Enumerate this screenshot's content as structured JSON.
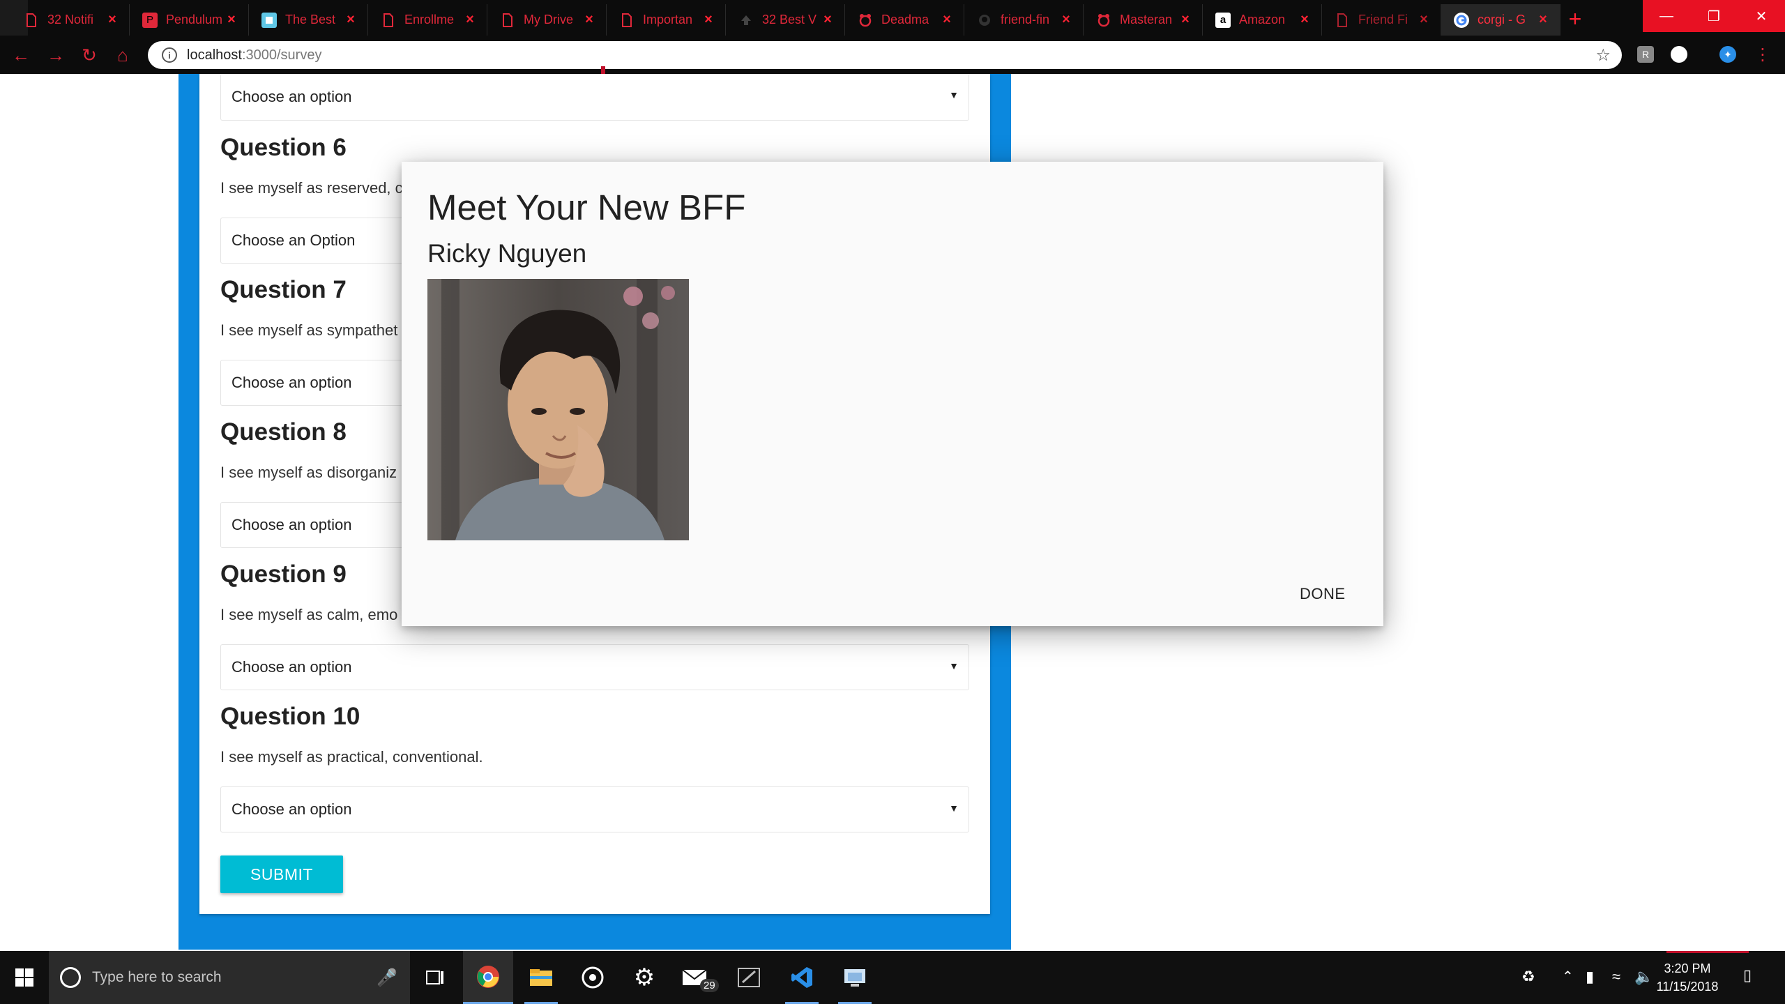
{
  "browser": {
    "tabs": [
      {
        "label": "32 Notifi",
        "icon": "document-icon",
        "active": false
      },
      {
        "label": "Pendulum",
        "icon": "pendulum-icon",
        "active": false
      },
      {
        "label": "The Best",
        "icon": "page-icon",
        "active": false
      },
      {
        "label": "Enrollme",
        "icon": "document-icon",
        "active": false
      },
      {
        "label": "My Drive",
        "icon": "document-icon",
        "active": false
      },
      {
        "label": "Importan",
        "icon": "document-icon",
        "active": false
      },
      {
        "label": "32 Best V",
        "icon": "upload-icon",
        "active": false
      },
      {
        "label": "Deadma",
        "icon": "deadmau5-icon",
        "active": false
      },
      {
        "label": "friend-fin",
        "icon": "github-icon",
        "active": false
      },
      {
        "label": "Masteran",
        "icon": "deadmau5-icon",
        "active": false
      },
      {
        "label": "Amazon",
        "icon": "amazon-icon",
        "active": false
      },
      {
        "label": "Friend Fi",
        "icon": "document-icon",
        "active": false
      },
      {
        "label": "corgi - G",
        "icon": "google-icon",
        "active": true
      }
    ],
    "url_host": "localhost",
    "url_path": ":3000/survey"
  },
  "survey": {
    "top_select": "Choose an option",
    "questions": [
      {
        "title": "Question 6",
        "text": "I see myself as reserved, c",
        "select": "Choose an Option"
      },
      {
        "title": "Question 7",
        "text": "I see myself as sympathet",
        "select": "Choose an option"
      },
      {
        "title": "Question 8",
        "text": "I see myself as disorganiz",
        "select": "Choose an option"
      },
      {
        "title": "Question 9",
        "text": "I see myself as calm, emo",
        "select": "Choose an option"
      },
      {
        "title": "Question 10",
        "text": "I see myself as practical, conventional.",
        "select": "Choose an option"
      }
    ],
    "submit_label": "SUBMIT"
  },
  "modal": {
    "title": "Meet Your New BFF",
    "friend_name": "Ricky Nguyen",
    "done_label": "DONE"
  },
  "taskbar": {
    "search_placeholder": "Type here to search",
    "mail_badge": "29",
    "time": "3:20 PM",
    "date": "11/15/2018"
  },
  "colors": {
    "page_accent": "#0b88de",
    "submit": "#00bcd4",
    "browser_accent": "#e0283a"
  }
}
